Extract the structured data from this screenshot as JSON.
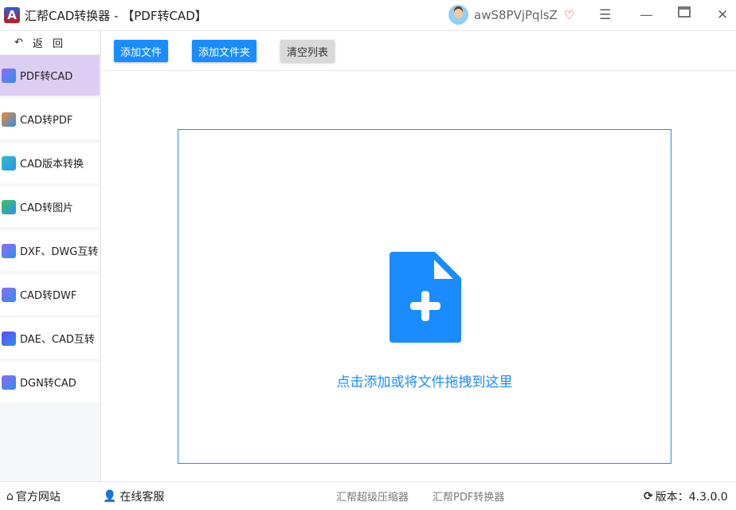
{
  "titlebar": {
    "logo": "A",
    "title": "汇帮CAD转换器 - 【PDF转CAD】",
    "username": "awS8PVjPqlsZ"
  },
  "sidebar": {
    "back": "返 回",
    "items": [
      {
        "label": "PDF转CAD",
        "active": true
      },
      {
        "label": "CAD转PDF"
      },
      {
        "label": "CAD版本转换"
      },
      {
        "label": "CAD转图片"
      },
      {
        "label": "DXF、DWG互转"
      },
      {
        "label": "CAD转DWF"
      },
      {
        "label": "DAE、CAD互转"
      },
      {
        "label": "DGN转CAD"
      }
    ]
  },
  "toolbar": {
    "add_file": "添加文件",
    "add_folder": "添加文件夹",
    "clear_list": "清空列表"
  },
  "dropzone": {
    "hint": "点击添加或将文件拖拽到这里"
  },
  "footer": {
    "website": "官方网站",
    "support": "在线客服",
    "link1": "汇帮超级压缩器",
    "link2": "汇帮PDF转换器",
    "version": "版本：4.3.0.0"
  },
  "colors": {
    "accent": "#1a8cff",
    "active_nav": "#dccdf2"
  }
}
